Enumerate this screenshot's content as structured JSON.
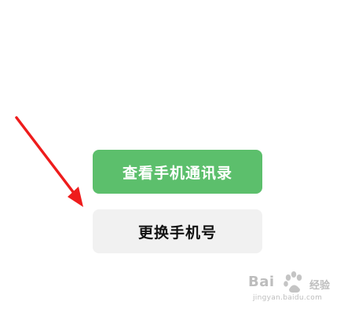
{
  "buttons": {
    "view_contacts_label": "查看手机通讯录",
    "change_phone_label": "更换手机号"
  },
  "colors": {
    "primary_green": "#5cbf6c",
    "secondary_gray": "#f1f1f1",
    "arrow_red": "#ee1c1c"
  },
  "watermark": {
    "brand": "Bai",
    "sub": "经验",
    "url": "jingyan.baidu.com"
  },
  "icons": {
    "annotation_arrow": "red-arrow-icon",
    "watermark_paw": "baidu-paw-icon"
  }
}
